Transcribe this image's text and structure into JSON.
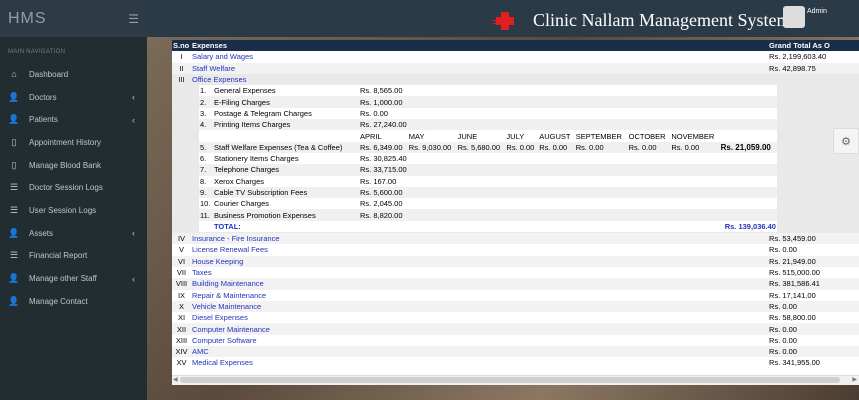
{
  "sidebar": {
    "logo": "HMS",
    "nav_header": "MAIN NAVIGATION",
    "items": [
      {
        "label": "Dashboard",
        "icon": "dashboard-icon",
        "glyph": "⌂",
        "chevron": false
      },
      {
        "label": "Doctors",
        "icon": "user-icon",
        "glyph": "👤",
        "chevron": true
      },
      {
        "label": "Patients",
        "icon": "user-icon",
        "glyph": "👤",
        "chevron": true
      },
      {
        "label": "Appointment History",
        "icon": "file-icon",
        "glyph": "▯",
        "chevron": false
      },
      {
        "label": "Manage Blood Bank",
        "icon": "file-icon",
        "glyph": "▯",
        "chevron": false
      },
      {
        "label": "Doctor Session Logs",
        "icon": "list-icon",
        "glyph": "☰",
        "chevron": false
      },
      {
        "label": "User Session Logs",
        "icon": "list-icon",
        "glyph": "☰",
        "chevron": false
      },
      {
        "label": "Assets",
        "icon": "user-icon",
        "glyph": "👤",
        "chevron": true
      },
      {
        "label": "Financial Report",
        "icon": "list-icon",
        "glyph": "☰",
        "chevron": false
      },
      {
        "label": "Manage other Staff",
        "icon": "user-icon",
        "glyph": "👤",
        "chevron": true
      },
      {
        "label": "Manage Contact",
        "icon": "user-icon",
        "glyph": "👤",
        "chevron": false
      }
    ]
  },
  "header": {
    "title": "Clinic Nallam Management System",
    "user": "Admin"
  },
  "table": {
    "headers": [
      "S.no",
      "Expenses",
      "Grand Total As O"
    ],
    "rows_top": [
      {
        "no": "I",
        "name": "Salary and Wages",
        "total": "Rs. 2,199,603.40"
      },
      {
        "no": "II",
        "name": "Staff Welfare",
        "total": "Rs. 42,898.75"
      }
    ],
    "office": {
      "no": "III",
      "name": "Office Expenses",
      "items": [
        {
          "n": "1.",
          "name": "General Expenses",
          "amt": "Rs. 8,565.00"
        },
        {
          "n": "2.",
          "name": "E-Filing Charges",
          "amt": "Rs. 1,000.00"
        },
        {
          "n": "3.",
          "name": "Postage & Telegram Charges",
          "amt": "Rs. 0.00"
        },
        {
          "n": "4.",
          "name": "Printing Items Charges",
          "amt": "Rs. 27,240.00"
        }
      ],
      "months": [
        "APRIL",
        "MAY",
        "JUNE",
        "JULY",
        "AUGUST",
        "SEPTEMBER",
        "OCTOBER",
        "NOVEMBER"
      ],
      "welfare": {
        "n": "5.",
        "name": "Staff Welfare Expenses (Tea & Coffee)",
        "values": [
          "Rs. 6,349.00",
          "Rs. 9,030.00",
          "Rs. 5,680.00",
          "Rs. 0.00",
          "Rs. 0.00",
          "Rs. 0.00",
          "Rs. 0.00",
          "Rs. 0.00"
        ],
        "total": "Rs. 21,059.00"
      },
      "items2": [
        {
          "n": "6.",
          "name": "Stationery Items Charges",
          "amt": "Rs. 30,825.40"
        },
        {
          "n": "7.",
          "name": "Telephone Charges",
          "amt": "Rs. 33,715.00"
        },
        {
          "n": "8.",
          "name": "Xerox Charges",
          "amt": "Rs. 167.00"
        },
        {
          "n": "9.",
          "name": "Cable TV Subscription Fees",
          "amt": "Rs. 5,600.00"
        },
        {
          "n": "10.",
          "name": "Courier Charges",
          "amt": "Rs. 2,045.00"
        },
        {
          "n": "11.",
          "name": "Business Promotion Expenses",
          "amt": "Rs. 8,820.00"
        }
      ],
      "total_label": "TOTAL:",
      "total_value": "Rs. 139,036.40"
    },
    "rows_bottom": [
      {
        "no": "IV",
        "name": "Insurance - Fire Insurance",
        "total": "Rs. 53,459.00"
      },
      {
        "no": "V",
        "name": "License Renewal Fees",
        "total": "Rs. 0.00"
      },
      {
        "no": "VI",
        "name": "House Keeping",
        "total": "Rs. 21,949.00"
      },
      {
        "no": "VII",
        "name": "Taxes",
        "total": "Rs. 515,000.00"
      },
      {
        "no": "VIII",
        "name": "Building Maintenance",
        "total": "Rs. 381,586.41"
      },
      {
        "no": "IX",
        "name": "Repair & Maintenance",
        "total": "Rs. 17,141.00"
      },
      {
        "no": "X",
        "name": "Vehicle Maintenance",
        "total": "Rs. 0.00"
      },
      {
        "no": "XI",
        "name": "Diesel Expenses",
        "total": "Rs. 58,800.00"
      },
      {
        "no": "XII",
        "name": "Computer Maintenance",
        "total": "Rs. 0.00"
      },
      {
        "no": "XIII",
        "name": "Computer Software",
        "total": "Rs. 0.00"
      },
      {
        "no": "XIV",
        "name": "AMC",
        "total": "Rs. 0.00"
      },
      {
        "no": "XV",
        "name": "Medical Expenses",
        "total": "Rs. 341,955.00"
      }
    ]
  }
}
